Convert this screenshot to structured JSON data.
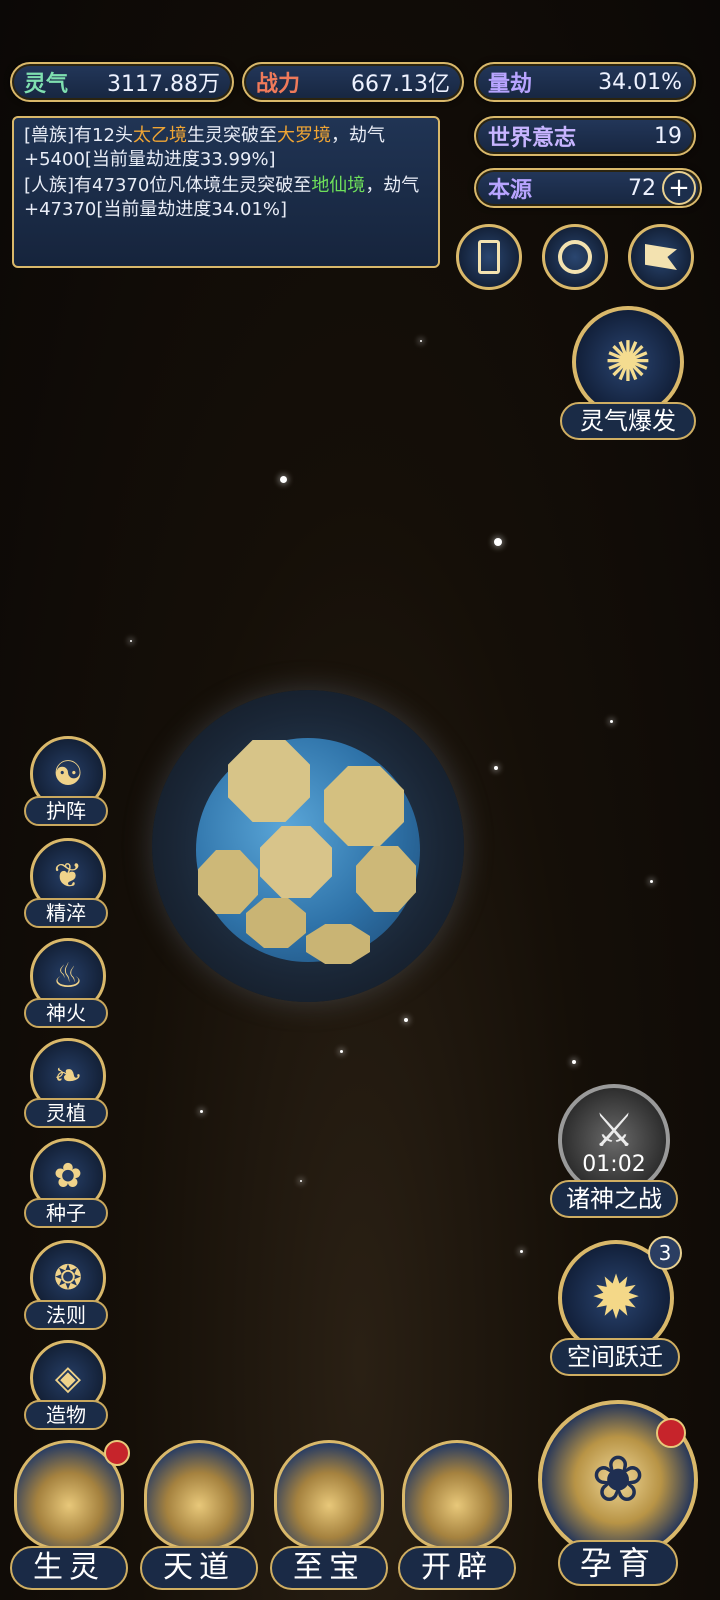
{
  "top_stats": {
    "lingqi": {
      "label": "灵气",
      "value": "3117.88万"
    },
    "zhanli": {
      "label": "战力",
      "value": "667.13亿"
    },
    "liangjie": {
      "label": "量劫",
      "value": "34.01%"
    },
    "world_will": {
      "label": "世界意志",
      "value": "19"
    },
    "origin": {
      "label": "本源",
      "value": "72"
    }
  },
  "log": {
    "entry1": {
      "prefix": "[兽族]有12头",
      "realm1": "太乙境",
      "mid": "生灵突破至",
      "realm2": "大罗境",
      "suffix": "，劫气+5400[当前量劫进度33.99%]"
    },
    "entry2": {
      "prefix": "[人族]有47370位凡体境生灵突破至",
      "realm": "地仙境",
      "suffix": "，劫气+47370[当前量劫进度34.01%]"
    }
  },
  "top_icons": [
    "book-icon",
    "shield-ring-icon",
    "flag-icon"
  ],
  "burst_button": {
    "label": "灵气爆发"
  },
  "side_buttons": [
    {
      "label": "护阵",
      "icon": "yin-yang-icon"
    },
    {
      "label": "精淬",
      "icon": "lotus-flame-icon"
    },
    {
      "label": "神火",
      "icon": "fire-icon"
    },
    {
      "label": "灵植",
      "icon": "plant-icon"
    },
    {
      "label": "种子",
      "icon": "flower-icon"
    },
    {
      "label": "法则",
      "icon": "rune-icon"
    },
    {
      "label": "造物",
      "icon": "diamond-icon"
    }
  ],
  "war_button": {
    "label": "诸神之战",
    "timer": "01:02"
  },
  "space_button": {
    "label": "空间跃迁",
    "badge": "3"
  },
  "bottom_nav": [
    {
      "label": "生灵"
    },
    {
      "label": "天道"
    },
    {
      "label": "至宝"
    },
    {
      "label": "开辟"
    }
  ],
  "nurture_button": {
    "label": "孕育"
  },
  "colors": {
    "gold": "#d9b86a",
    "panel": "#1b2c48",
    "realm_orange": "#f0a534",
    "realm_green": "#6ee05a"
  }
}
